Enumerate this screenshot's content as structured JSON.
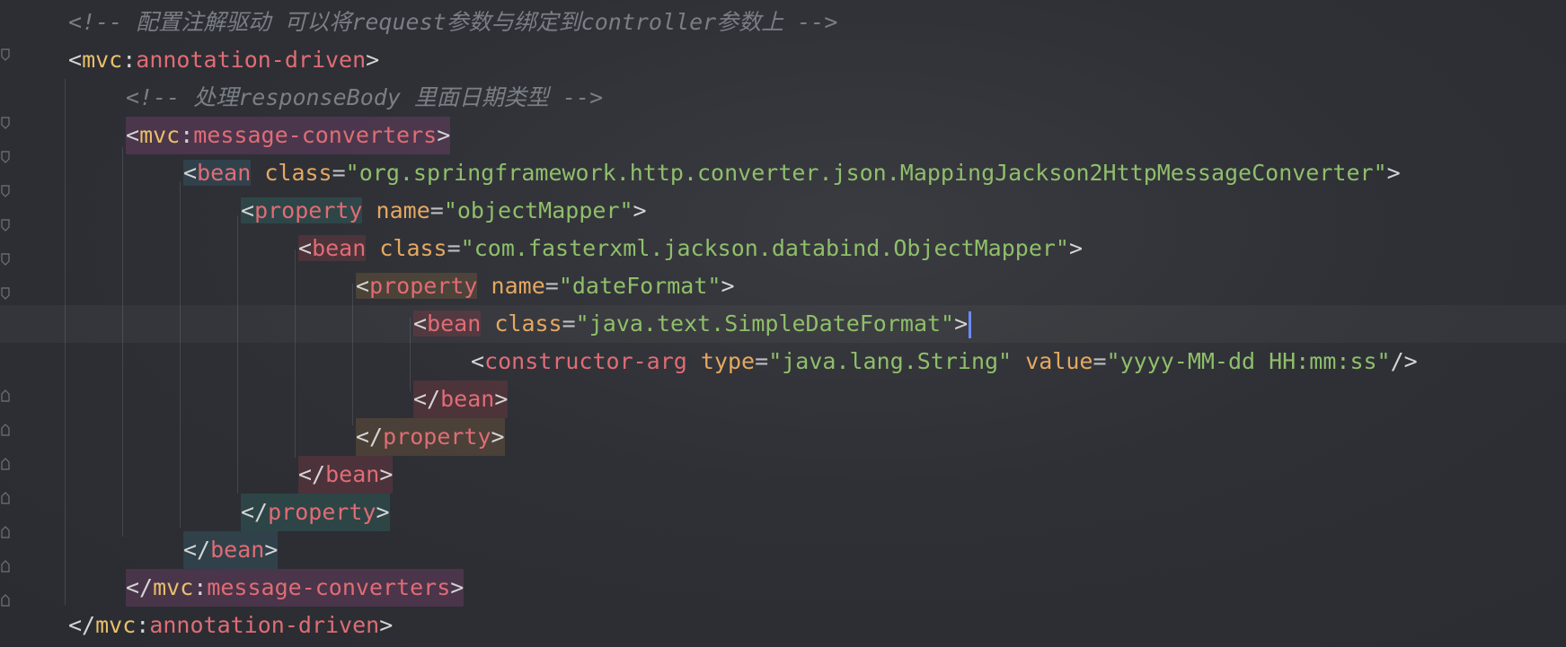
{
  "gutter": {
    "fold_icons": [
      "fold-open-icon",
      "fold-open-icon",
      "fold-open-icon",
      "fold-open-icon",
      "fold-open-icon",
      "fold-open-icon",
      "fold-open-icon",
      "fold-close-icon",
      "fold-close-icon",
      "fold-close-icon",
      "fold-close-icon",
      "fold-close-icon",
      "fold-close-icon",
      "fold-close-icon"
    ]
  },
  "lines": [
    {
      "comment": "<!-- 配置注解驱动 可以将request参数与绑定到controller参数上 -->"
    },
    {
      "open": "<",
      "ns": "mvc",
      "colon": ":",
      "tag": "annotation-driven",
      "close": ">"
    },
    {
      "comment": "<!-- 处理responseBody 里面日期类型 -->"
    },
    {
      "open": "<",
      "ns": "mvc",
      "colon": ":",
      "tag": "message-converters",
      "close": ">"
    },
    {
      "open": "<",
      "tag": "bean",
      "attr1": "class",
      "eq1": "=",
      "val1": "\"org.springframework.http.converter.json.MappingJackson2HttpMessageConverter\"",
      "close": ">"
    },
    {
      "open": "<",
      "tag": "property",
      "attr1": "name",
      "eq1": "=",
      "val1": "\"objectMapper\"",
      "close": ">"
    },
    {
      "open": "<",
      "tag": "bean",
      "attr1": "class",
      "eq1": "=",
      "val1": "\"com.fasterxml.jackson.databind.ObjectMapper\"",
      "close": ">"
    },
    {
      "open": "<",
      "tag": "property",
      "attr1": "name",
      "eq1": "=",
      "val1": "\"dateFormat\"",
      "close": ">"
    },
    {
      "open": "<",
      "tag": "bean",
      "attr1": "class",
      "eq1": "=",
      "val1": "\"java.text.SimpleDateFormat\"",
      "close": ">"
    },
    {
      "open": "<",
      "tag": "constructor-arg",
      "attr1": "type",
      "eq1": "=",
      "val1": "\"java.lang.String\"",
      "attr2": "value",
      "eq2": "=",
      "val2": "\"yyyy-MM-dd HH:mm:ss\"",
      "close": "/>"
    },
    {
      "open": "</",
      "tag": "bean",
      "close": ">"
    },
    {
      "open": "</",
      "tag": "property",
      "close": ">"
    },
    {
      "open": "</",
      "tag": "bean",
      "close": ">"
    },
    {
      "open": "</",
      "tag": "property",
      "close": ">"
    },
    {
      "open": "</",
      "tag": "bean",
      "close": ">"
    },
    {
      "open": "</",
      "ns": "mvc",
      "colon": ":",
      "tag": "message-converters",
      "close": ">"
    },
    {
      "open": "</",
      "ns": "mvc",
      "colon": ":",
      "tag": "annotation-driven",
      "close": ">"
    }
  ],
  "colors": {
    "background": "#2d2f35",
    "comment": "#7a7e85",
    "namespace": "#e8bf6a",
    "tag": "#e06c75",
    "attribute": "#e5a860",
    "string": "#8fbf6a",
    "caret": "#6b8cff"
  }
}
